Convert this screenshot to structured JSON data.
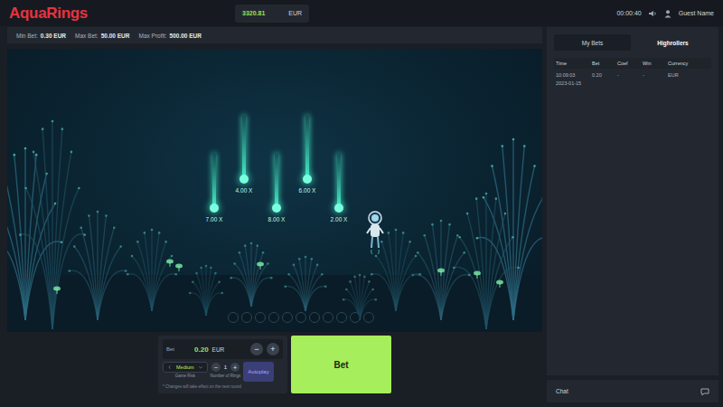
{
  "logo": "AquaRings",
  "balance": {
    "amount": "3320.81",
    "currency": "EUR"
  },
  "timer": "00:00:40",
  "user": "Guest Name",
  "limits": [
    {
      "label": "Min Bet:",
      "value": "0.30 EUR"
    },
    {
      "label": "Max Bet:",
      "value": "50.00 EUR"
    },
    {
      "label": "Max Profit:",
      "value": "500.00 EUR"
    }
  ],
  "scene": {
    "multipliers": [
      {
        "label": "7.00 X"
      },
      {
        "label": "4.00 X"
      },
      {
        "label": "8.00 X"
      },
      {
        "label": "6.00 X"
      },
      {
        "label": "2.00 X"
      }
    ],
    "ring_slots": [
      {
        "filled": false
      },
      {
        "filled": false
      },
      {
        "filled": false
      },
      {
        "filled": false
      },
      {
        "filled": false
      },
      {
        "filled": false
      },
      {
        "filled": false
      },
      {
        "filled": false
      },
      {
        "filled": false
      },
      {
        "filled": false
      },
      {
        "filled": false
      }
    ]
  },
  "bet_panel": {
    "label": "Bet",
    "amount": "0.20",
    "currency": "EUR",
    "minus": "−",
    "plus": "+",
    "risk": {
      "value": "Medium",
      "label": "Game Risk"
    },
    "rings": {
      "value": "1",
      "label": "Number of Rings",
      "minus": "−",
      "plus": "+"
    },
    "autoplay": "Autoplay",
    "note": "* Changes will take effect on the next round"
  },
  "bet_button": "Bet",
  "side": {
    "tabs": [
      {
        "label": "My Bets",
        "selected": true
      },
      {
        "label": "Highrollers",
        "selected": false
      }
    ],
    "columns": [
      "Time",
      "Bet",
      "Coef",
      "Win",
      "Currency"
    ],
    "rows": [
      [
        "10:09:03\n2023-01-15",
        "0.20",
        "-",
        "-",
        "EUR"
      ]
    ]
  },
  "chat": "Chat"
}
